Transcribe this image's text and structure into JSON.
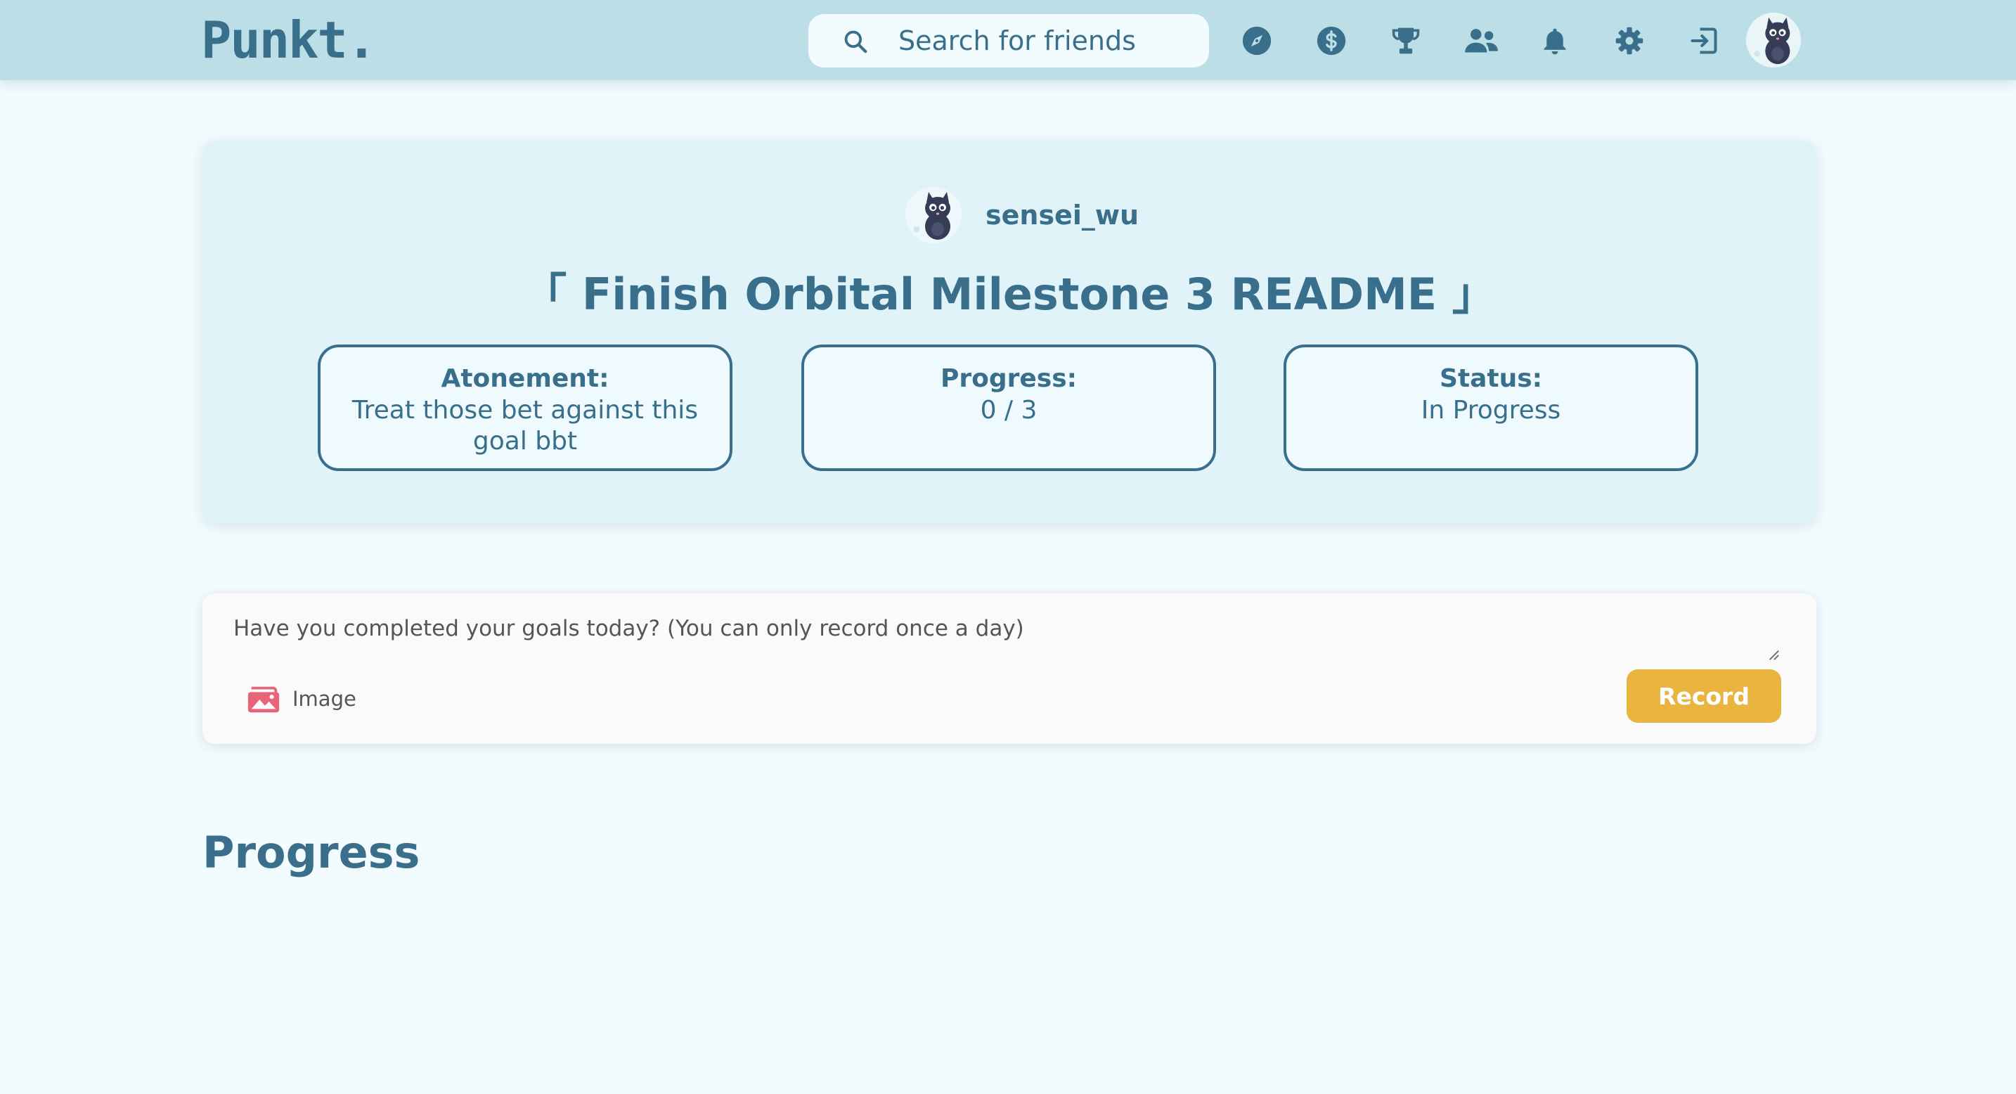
{
  "app": {
    "logo": "Punkt."
  },
  "search": {
    "placeholder": "Search for friends"
  },
  "nav": {
    "icons": [
      "compass-icon",
      "dollar-icon",
      "trophy-icon",
      "friends-icon",
      "bell-icon",
      "gear-icon",
      "logout-icon"
    ]
  },
  "goal": {
    "owner": "sensei_wu",
    "title": "「 Finish Orbital Milestone 3 README 」",
    "atonement_label": "Atonement:",
    "atonement_value": "Treat those bet against this goal bbt",
    "progress_label": "Progress:",
    "progress_value": "0 / 3",
    "status_label": "Status:",
    "status_value": "In Progress"
  },
  "record": {
    "placeholder": "Have you completed your goals today? (You can only record once a day)",
    "image_label": "Image",
    "button_label": "Record"
  },
  "progress_section": {
    "heading": "Progress"
  },
  "colors": {
    "primary": "#3a6f8b",
    "navbar": "#bcdee7",
    "page_bg": "#f2fbfe",
    "card_bg": "#e0f3f8",
    "accent": "#e9b43f",
    "image_icon": "#e86478"
  }
}
